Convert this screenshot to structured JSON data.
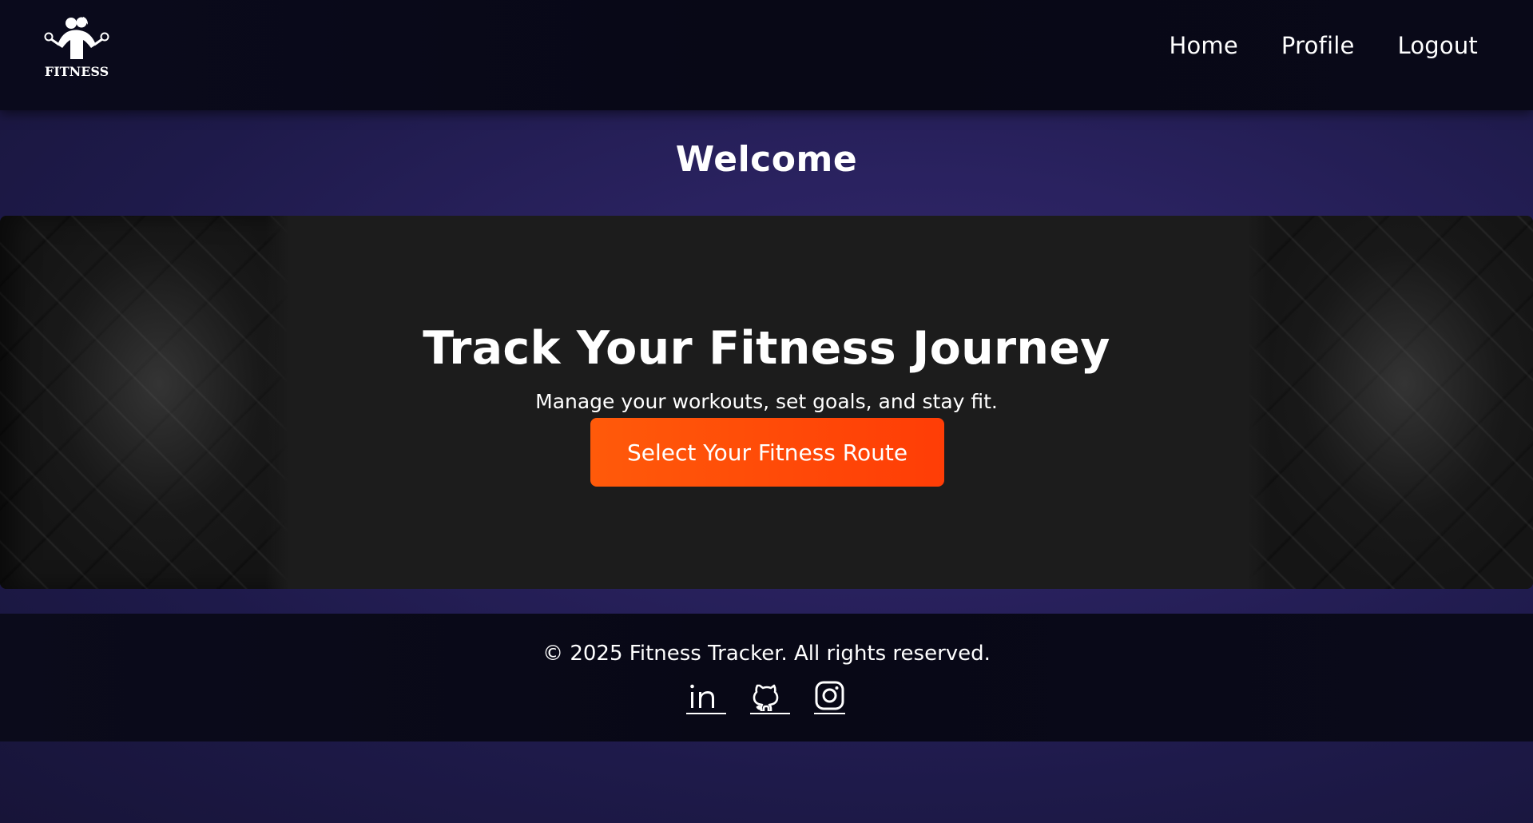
{
  "header": {
    "logo_text": "FITNESS",
    "nav": [
      {
        "label": "Home"
      },
      {
        "label": "Profile"
      },
      {
        "label": "Logout"
      }
    ]
  },
  "main": {
    "welcome": "Welcome",
    "hero": {
      "title": "Track Your Fitness Journey",
      "subtitle": "Manage your workouts, set goals, and stay fit.",
      "cta_label": "Select Your Fitness Route"
    }
  },
  "footer": {
    "copyright": "© 2025 Fitness Tracker. All rights reserved.",
    "socials": [
      {
        "icon": "linkedin-icon"
      },
      {
        "icon": "github-icon"
      },
      {
        "icon": "instagram-icon"
      }
    ]
  },
  "colors": {
    "accent": "#ff4b08",
    "navbar": "#08081a",
    "background": "#2a2260",
    "hero": "#1c1c1c"
  }
}
